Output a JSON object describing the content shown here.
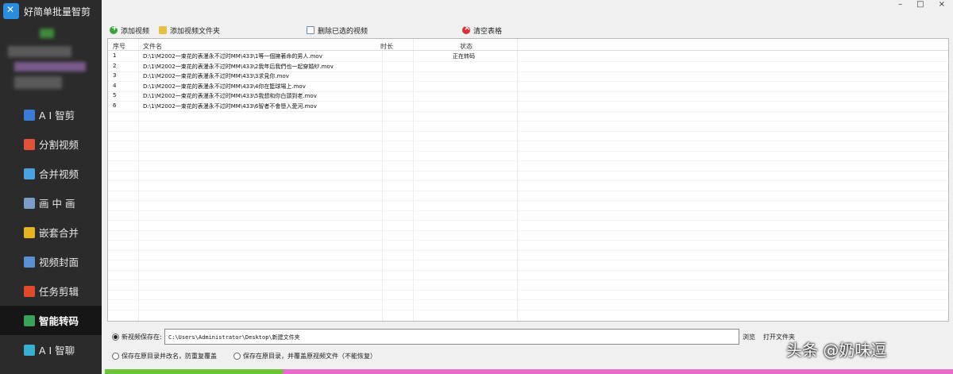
{
  "app": {
    "title": "好简单批量智剪"
  },
  "window_controls": {
    "minimize": "–",
    "maximize": "□",
    "close": "×"
  },
  "sidebar": {
    "items": [
      {
        "label": "A I 智剪",
        "icon": "ai-edit-icon",
        "color": "#3a7bd5",
        "active": false
      },
      {
        "label": "分割视频",
        "icon": "split-video-icon",
        "color": "#e0533a",
        "active": false
      },
      {
        "label": "合并视频",
        "icon": "merge-video-icon",
        "color": "#4aa3df",
        "active": false
      },
      {
        "label": "画 中 画",
        "icon": "pip-icon",
        "color": "#7a9ec9",
        "active": false
      },
      {
        "label": "嵌套合并",
        "icon": "nested-merge-icon",
        "color": "#e6b422",
        "active": false
      },
      {
        "label": "视频封面",
        "icon": "video-cover-icon",
        "color": "#5a8fd0",
        "active": false
      },
      {
        "label": "任务剪辑",
        "icon": "task-edit-icon",
        "color": "#e04a2a",
        "active": false
      },
      {
        "label": "智能转码",
        "icon": "transcode-icon",
        "color": "#3aa05a",
        "active": true
      },
      {
        "label": "A I 智聊",
        "icon": "ai-chat-icon",
        "color": "#3ab0d0",
        "active": false
      }
    ]
  },
  "toolbar": {
    "add_video": "添加视频",
    "add_folder": "添加视频文件夹",
    "delete_selected": "删除已选的视频",
    "clear_table": "清空表格"
  },
  "table": {
    "headers": {
      "index": "序号",
      "filename": "文件名",
      "duration": "时长",
      "status": "状态"
    },
    "rows": [
      {
        "index": "1",
        "filename": "D:\\1\\M2002一束花的表漫永不过时MM\\433\\1等一個擁著命的男人.mov",
        "duration": "",
        "status": "正在转码"
      },
      {
        "index": "2",
        "filename": "D:\\1\\M2002一束花的表漫永不过时MM\\433\\2我年后我們也一起穿婚紗.mov",
        "duration": "",
        "status": ""
      },
      {
        "index": "3",
        "filename": "D:\\1\\M2002一束花的表漫永不过时MM\\433\\3求見你.mov",
        "duration": "",
        "status": ""
      },
      {
        "index": "4",
        "filename": "D:\\1\\M2002一束花的表漫永不过时MM\\433\\4你在籃球場上.mov",
        "duration": "",
        "status": ""
      },
      {
        "index": "5",
        "filename": "D:\\1\\M2002一束花的表漫永不过时MM\\433\\5我想和你白頭到老.mov",
        "duration": "",
        "status": ""
      },
      {
        "index": "6",
        "filename": "D:\\1\\M2002一束花的表漫永不过时MM\\433\\6智者不會墮入愛河.mov",
        "duration": "",
        "status": ""
      }
    ]
  },
  "output": {
    "save_new_label": "新视频保存在:",
    "save_path": "C:\\Users\\Administrator\\Desktop\\新建文件夹",
    "browse": "浏览",
    "open_folder": "打开文件夹",
    "opt_rename": "保存在原目录并改名，防重复覆盖",
    "opt_overwrite": "保存在原目录，并覆盖原视频文件（不能恢复）"
  },
  "progress": {
    "fraction": 0.21,
    "fill_color": "#6bc435",
    "track_color": "#e86acb"
  },
  "watermark": "头条 @奶味逗"
}
